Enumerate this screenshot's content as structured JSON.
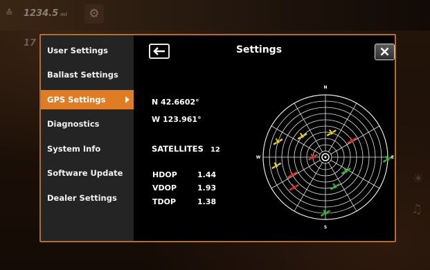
{
  "background": {
    "readout_top": "1234.5",
    "readout_unit": "mi",
    "readout_second": "17"
  },
  "menu": {
    "items": [
      {
        "label": "User Settings",
        "active": false
      },
      {
        "label": "Ballast Settings",
        "active": false
      },
      {
        "label": "GPS Settings",
        "active": true
      },
      {
        "label": "Diagnostics",
        "active": false
      },
      {
        "label": "System Info",
        "active": false
      },
      {
        "label": "Software Update",
        "active": false
      },
      {
        "label": "Dealer Settings",
        "active": false
      }
    ]
  },
  "header": {
    "title": "Settings",
    "back_icon": "arrow-left-icon",
    "close_icon": "close-x-icon"
  },
  "gps": {
    "latitude": "N 42.6602°",
    "longitude": "W 123.961°",
    "satellites_label": "SATELLITES",
    "satellites_count": "12",
    "hdop_label": "HDOP",
    "hdop_value": "1.44",
    "vdop_label": "VDOP",
    "vdop_value": "1.93",
    "tdop_label": "TDOP",
    "tdop_value": "1.38"
  },
  "skyplot": {
    "directions": {
      "n": "N",
      "e": "E",
      "s": "S",
      "w": "W"
    },
    "status_colors": {
      "yellow": "#e6d21e",
      "red": "#d93a30",
      "green": "#36b83c"
    },
    "satellites": [
      {
        "azimuth_deg": 14,
        "elevation_deg": 54,
        "status": "yellow"
      },
      {
        "azimuth_deg": 58,
        "elevation_deg": 45,
        "status": "red"
      },
      {
        "azimuth_deg": 92,
        "elevation_deg": 0,
        "status": "green"
      },
      {
        "azimuth_deg": 124,
        "elevation_deg": 54,
        "status": "green"
      },
      {
        "azimuth_deg": 162,
        "elevation_deg": 45,
        "status": "green"
      },
      {
        "azimuth_deg": 180,
        "elevation_deg": 9,
        "status": "green"
      },
      {
        "azimuth_deg": 270,
        "elevation_deg": 72,
        "status": "red"
      },
      {
        "azimuth_deg": 312,
        "elevation_deg": 45,
        "status": "yellow"
      },
      {
        "azimuth_deg": 288,
        "elevation_deg": 18,
        "status": "yellow"
      },
      {
        "azimuth_deg": 260,
        "elevation_deg": 18,
        "status": "yellow"
      },
      {
        "azimuth_deg": 242,
        "elevation_deg": 36,
        "status": "red"
      },
      {
        "azimuth_deg": 226,
        "elevation_deg": 27,
        "status": "red"
      }
    ]
  },
  "colors": {
    "accent": "#e07d24",
    "border": "#b56e27",
    "menu_bg": "#242424"
  }
}
